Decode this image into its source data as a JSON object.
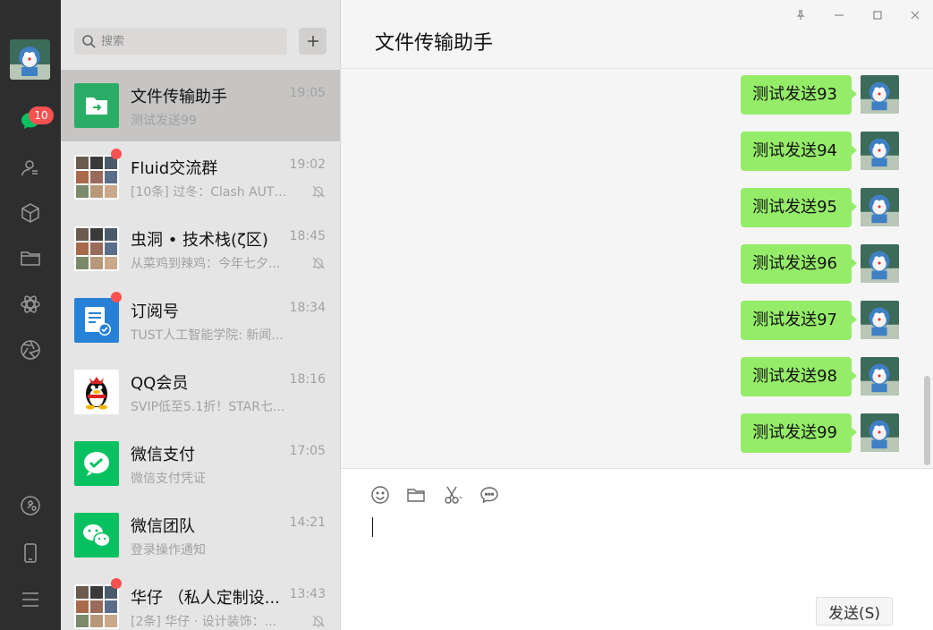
{
  "window": {
    "title": "文件传输助手"
  },
  "rail": {
    "unread_badge": "10"
  },
  "search": {
    "placeholder": "搜索"
  },
  "conversations": [
    {
      "name": "文件传输助手",
      "time": "19:05",
      "preview": "测试发送99",
      "avatar": "file-transfer",
      "active": true,
      "dot": false,
      "muted": false
    },
    {
      "name": "Fluid交流群",
      "time": "19:02",
      "preview": "[10条] 过冬：Clash AUTO...",
      "avatar": "group",
      "active": false,
      "dot": true,
      "muted": true
    },
    {
      "name": "虫洞 • 技术栈(ζ区)",
      "time": "18:45",
      "preview": "从菜鸡到辣鸡：今年七夕...",
      "avatar": "group",
      "active": false,
      "dot": false,
      "muted": true
    },
    {
      "name": "订阅号",
      "time": "18:34",
      "preview": "TUST人工智能学院: 新闻...",
      "avatar": "subscription",
      "active": false,
      "dot": true,
      "muted": false
    },
    {
      "name": "QQ会员",
      "time": "18:16",
      "preview": "SVIP低至5.1折！STAR七...",
      "avatar": "qq",
      "active": false,
      "dot": false,
      "muted": false
    },
    {
      "name": "微信支付",
      "time": "17:05",
      "preview": "微信支付凭证",
      "avatar": "wechat-pay",
      "active": false,
      "dot": false,
      "muted": false
    },
    {
      "name": "微信团队",
      "time": "14:21",
      "preview": "登录操作通知",
      "avatar": "wechat-team",
      "active": false,
      "dot": false,
      "muted": false
    },
    {
      "name": "华仔 （私人定制设...",
      "time": "13:43",
      "preview": "[2条] 华仔 · 设计装饰：...",
      "avatar": "group",
      "active": false,
      "dot": true,
      "muted": true
    }
  ],
  "messages": [
    {
      "text": "测试发送93"
    },
    {
      "text": "测试发送94"
    },
    {
      "text": "测试发送95"
    },
    {
      "text": "测试发送96"
    },
    {
      "text": "测试发送97"
    },
    {
      "text": "测试发送98"
    },
    {
      "text": "测试发送99"
    }
  ],
  "composer": {
    "send_label": "发送(S)"
  },
  "colors": {
    "rail": "#2e2e2e",
    "list": "#e6e5e5",
    "bubble": "#95ec69",
    "badge": "#fa5151",
    "wechat_green": "#07c160"
  }
}
